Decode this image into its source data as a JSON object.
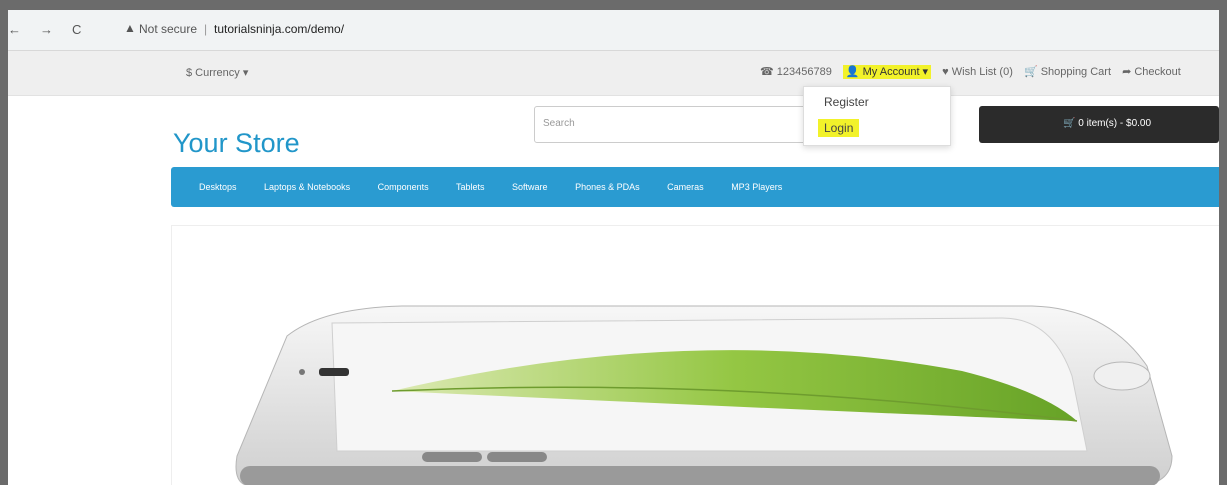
{
  "browser": {
    "back": "←",
    "forward": "→",
    "reload": "C",
    "security": "Not secure",
    "separator": "|",
    "url": "tutorialsninja.com/demo/"
  },
  "topbar": {
    "currency": "$ Currency ▾",
    "phone": "☎ 123456789",
    "my_account": "👤 My Account ▾",
    "wishlist": "♥ Wish List (0)",
    "shopping_cart": "🛒 Shopping Cart",
    "checkout": "➦ Checkout"
  },
  "dropdown": {
    "register": "Register",
    "login": "Login"
  },
  "header": {
    "logo": "Your Store",
    "search_placeholder": "Search",
    "cart": "🛒 0 item(s) - $0.00"
  },
  "menu": [
    "Desktops",
    "Laptops & Notebooks",
    "Components",
    "Tablets",
    "Software",
    "Phones & PDAs",
    "Cameras",
    "MP3 Players"
  ],
  "colors": {
    "accent": "#2a9bd1",
    "highlight": "#f2f22a",
    "logo": "#2196c9"
  }
}
